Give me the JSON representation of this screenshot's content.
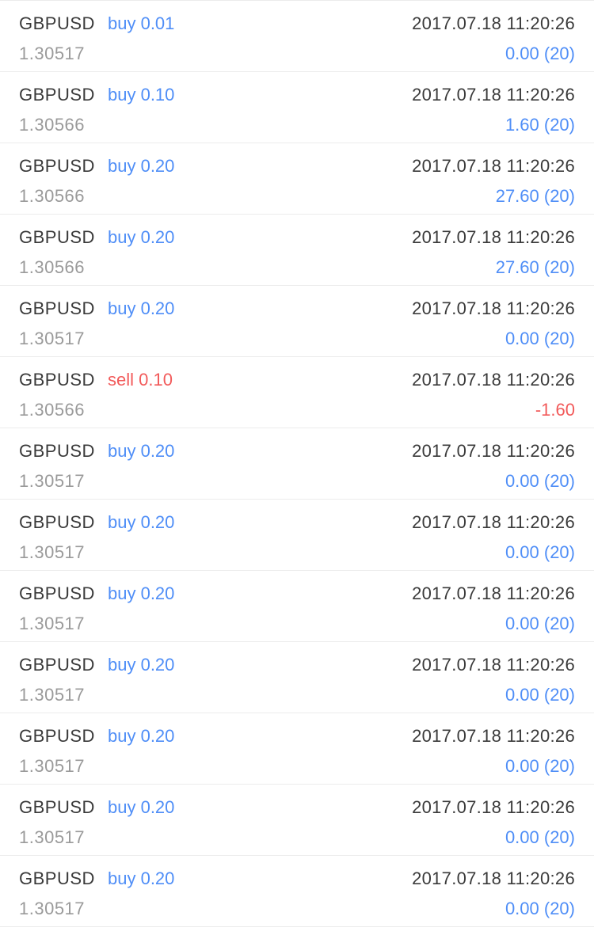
{
  "colors": {
    "buy": "#4f8ef7",
    "sell": "#f25a5a",
    "symbol_text": "#3a3a3a",
    "price_text": "#9a9a9a",
    "divider": "#ececec"
  },
  "orders": [
    {
      "symbol": "GBPUSD",
      "trade": "buy 0.01",
      "side": "buy",
      "time": "2017.07.18 11:20:26",
      "price": "1.30517",
      "profit": "0.00 (20)",
      "negative": false
    },
    {
      "symbol": "GBPUSD",
      "trade": "buy 0.10",
      "side": "buy",
      "time": "2017.07.18 11:20:26",
      "price": "1.30566",
      "profit": "1.60 (20)",
      "negative": false
    },
    {
      "symbol": "GBPUSD",
      "trade": "buy 0.20",
      "side": "buy",
      "time": "2017.07.18 11:20:26",
      "price": "1.30566",
      "profit": "27.60 (20)",
      "negative": false
    },
    {
      "symbol": "GBPUSD",
      "trade": "buy 0.20",
      "side": "buy",
      "time": "2017.07.18 11:20:26",
      "price": "1.30566",
      "profit": "27.60 (20)",
      "negative": false
    },
    {
      "symbol": "GBPUSD",
      "trade": "buy 0.20",
      "side": "buy",
      "time": "2017.07.18 11:20:26",
      "price": "1.30517",
      "profit": "0.00 (20)",
      "negative": false
    },
    {
      "symbol": "GBPUSD",
      "trade": "sell 0.10",
      "side": "sell",
      "time": "2017.07.18 11:20:26",
      "price": "1.30566",
      "profit": "-1.60",
      "negative": true
    },
    {
      "symbol": "GBPUSD",
      "trade": "buy 0.20",
      "side": "buy",
      "time": "2017.07.18 11:20:26",
      "price": "1.30517",
      "profit": "0.00 (20)",
      "negative": false
    },
    {
      "symbol": "GBPUSD",
      "trade": "buy 0.20",
      "side": "buy",
      "time": "2017.07.18 11:20:26",
      "price": "1.30517",
      "profit": "0.00 (20)",
      "negative": false
    },
    {
      "symbol": "GBPUSD",
      "trade": "buy 0.20",
      "side": "buy",
      "time": "2017.07.18 11:20:26",
      "price": "1.30517",
      "profit": "0.00 (20)",
      "negative": false
    },
    {
      "symbol": "GBPUSD",
      "trade": "buy 0.20",
      "side": "buy",
      "time": "2017.07.18 11:20:26",
      "price": "1.30517",
      "profit": "0.00 (20)",
      "negative": false
    },
    {
      "symbol": "GBPUSD",
      "trade": "buy 0.20",
      "side": "buy",
      "time": "2017.07.18 11:20:26",
      "price": "1.30517",
      "profit": "0.00 (20)",
      "negative": false
    },
    {
      "symbol": "GBPUSD",
      "trade": "buy 0.20",
      "side": "buy",
      "time": "2017.07.18 11:20:26",
      "price": "1.30517",
      "profit": "0.00 (20)",
      "negative": false
    },
    {
      "symbol": "GBPUSD",
      "trade": "buy 0.20",
      "side": "buy",
      "time": "2017.07.18 11:20:26",
      "price": "1.30517",
      "profit": "0.00 (20)",
      "negative": false
    }
  ]
}
